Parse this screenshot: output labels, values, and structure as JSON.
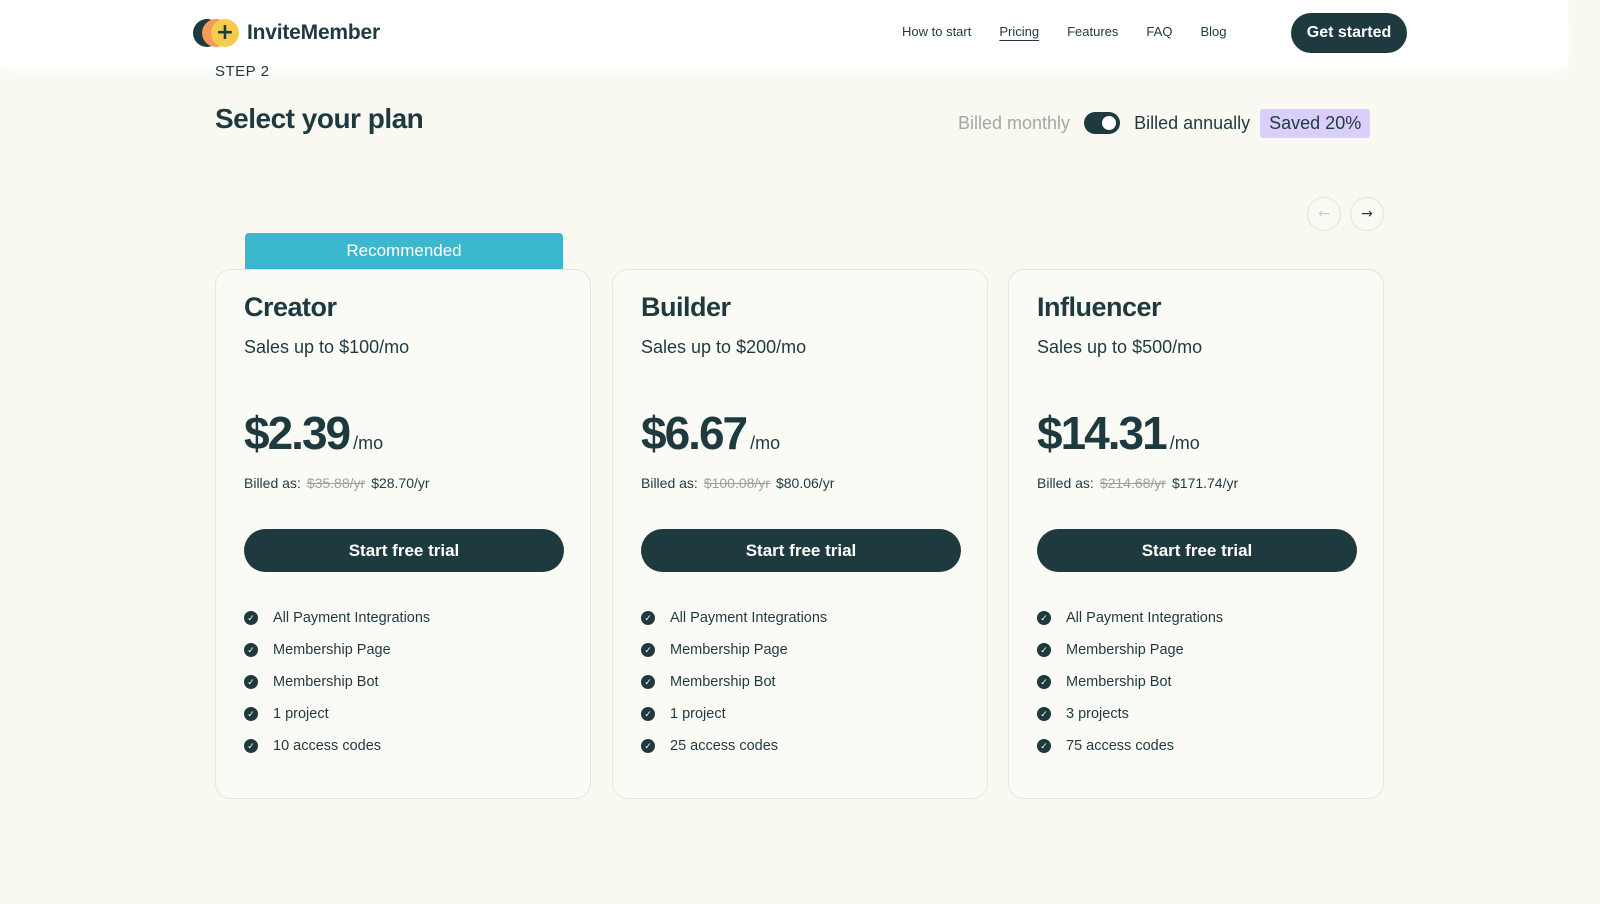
{
  "header": {
    "logo_text": "InviteMember",
    "nav": [
      "How to start",
      "Pricing",
      "Features",
      "FAQ",
      "Blog"
    ],
    "active_nav": "Pricing",
    "cta_label": "Get started"
  },
  "section": {
    "step_label": "STEP 2",
    "title": "Select your plan"
  },
  "billing": {
    "monthly_label": "Billed monthly",
    "annually_label": "Billed annually",
    "saved_badge": "Saved 20%",
    "annual_selected": true
  },
  "carousel": {
    "prev_icon": "arrow-left-icon",
    "next_icon": "arrow-right-icon"
  },
  "recommended_label": "Recommended",
  "plans": [
    {
      "name": "Creator",
      "subtitle": "Sales up to $100/mo",
      "price": "$2.39",
      "per": "/mo",
      "billed_label": "Billed as:",
      "old_price": "$35.88/yr",
      "new_price": "$28.70/yr",
      "button": "Start free trial",
      "features": [
        "All Payment Integrations",
        "Membership Page",
        "Membership Bot",
        "1 project",
        "10 access codes"
      ]
    },
    {
      "name": "Builder",
      "subtitle": "Sales up to $200/mo",
      "price": "$6.67",
      "per": "/mo",
      "billed_label": "Billed as:",
      "old_price": "$100.08/yr",
      "new_price": "$80.06/yr",
      "button": "Start free trial",
      "features": [
        "All Payment Integrations",
        "Membership Page",
        "Membership Bot",
        "1 project",
        "25 access codes"
      ]
    },
    {
      "name": "Influencer",
      "subtitle": "Sales up to $500/mo",
      "price": "$14.31",
      "per": "/mo",
      "billed_label": "Billed as:",
      "old_price": "$214.68/yr",
      "new_price": "$171.74/yr",
      "button": "Start free trial",
      "features": [
        "All Payment Integrations",
        "Membership Page",
        "Membership Bot",
        "3 projects",
        "75 access codes"
      ]
    }
  ],
  "colors": {
    "primary": "#1f3a3f",
    "accent_recommended": "#3bb8ce",
    "saved_badge_bg": "#d9cffa",
    "background": "#f9f9f2"
  }
}
